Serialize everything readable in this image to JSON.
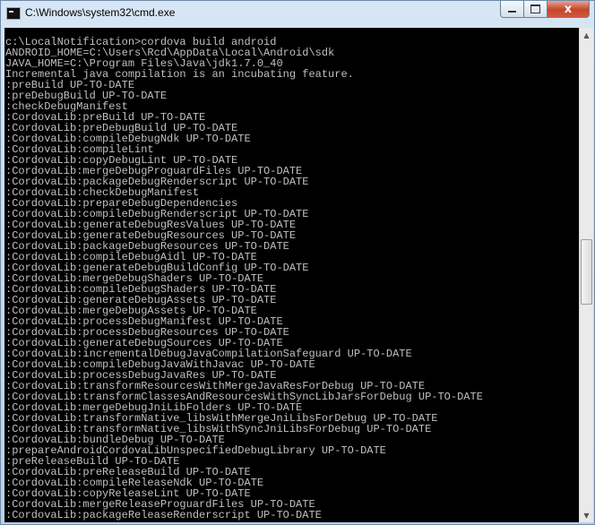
{
  "window": {
    "title": "C:\\Windows\\system32\\cmd.exe",
    "minimize_glyph": "",
    "close_glyph": "x"
  },
  "console": {
    "text": "c:\\LocalNotification>cordova build android\nANDROID_HOME=C:\\Users\\Rcd\\AppData\\Local\\Android\\sdk\nJAVA_HOME=C:\\Program Files\\Java\\jdk1.7.0_40\nIncremental java compilation is an incubating feature.\n:preBuild UP-TO-DATE\n:preDebugBuild UP-TO-DATE\n:checkDebugManifest\n:CordovaLib:preBuild UP-TO-DATE\n:CordovaLib:preDebugBuild UP-TO-DATE\n:CordovaLib:compileDebugNdk UP-TO-DATE\n:CordovaLib:compileLint\n:CordovaLib:copyDebugLint UP-TO-DATE\n:CordovaLib:mergeDebugProguardFiles UP-TO-DATE\n:CordovaLib:packageDebugRenderscript UP-TO-DATE\n:CordovaLib:checkDebugManifest\n:CordovaLib:prepareDebugDependencies\n:CordovaLib:compileDebugRenderscript UP-TO-DATE\n:CordovaLib:generateDebugResValues UP-TO-DATE\n:CordovaLib:generateDebugResources UP-TO-DATE\n:CordovaLib:packageDebugResources UP-TO-DATE\n:CordovaLib:compileDebugAidl UP-TO-DATE\n:CordovaLib:generateDebugBuildConfig UP-TO-DATE\n:CordovaLib:mergeDebugShaders UP-TO-DATE\n:CordovaLib:compileDebugShaders UP-TO-DATE\n:CordovaLib:generateDebugAssets UP-TO-DATE\n:CordovaLib:mergeDebugAssets UP-TO-DATE\n:CordovaLib:processDebugManifest UP-TO-DATE\n:CordovaLib:processDebugResources UP-TO-DATE\n:CordovaLib:generateDebugSources UP-TO-DATE\n:CordovaLib:incrementalDebugJavaCompilationSafeguard UP-TO-DATE\n:CordovaLib:compileDebugJavaWithJavac UP-TO-DATE\n:CordovaLib:processDebugJavaRes UP-TO-DATE\n:CordovaLib:transformResourcesWithMergeJavaResForDebug UP-TO-DATE\n:CordovaLib:transformClassesAndResourcesWithSyncLibJarsForDebug UP-TO-DATE\n:CordovaLib:mergeDebugJniLibFolders UP-TO-DATE\n:CordovaLib:transformNative_libsWithMergeJniLibsForDebug UP-TO-DATE\n:CordovaLib:transformNative_libsWithSyncJniLibsForDebug UP-TO-DATE\n:CordovaLib:bundleDebug UP-TO-DATE\n:prepareAndroidCordovaLibUnspecifiedDebugLibrary UP-TO-DATE\n:preReleaseBuild UP-TO-DATE\n:CordovaLib:preReleaseBuild UP-TO-DATE\n:CordovaLib:compileReleaseNdk UP-TO-DATE\n:CordovaLib:copyReleaseLint UP-TO-DATE\n:CordovaLib:mergeReleaseProguardFiles UP-TO-DATE\n:CordovaLib:packageReleaseRenderscript UP-TO-DATE"
  },
  "scrollbar": {
    "up_glyph": "▲",
    "down_glyph": "▼"
  },
  "colors": {
    "console_background": "#000000",
    "console_text": "#c0c0c0",
    "close_button": "#c5452b"
  }
}
